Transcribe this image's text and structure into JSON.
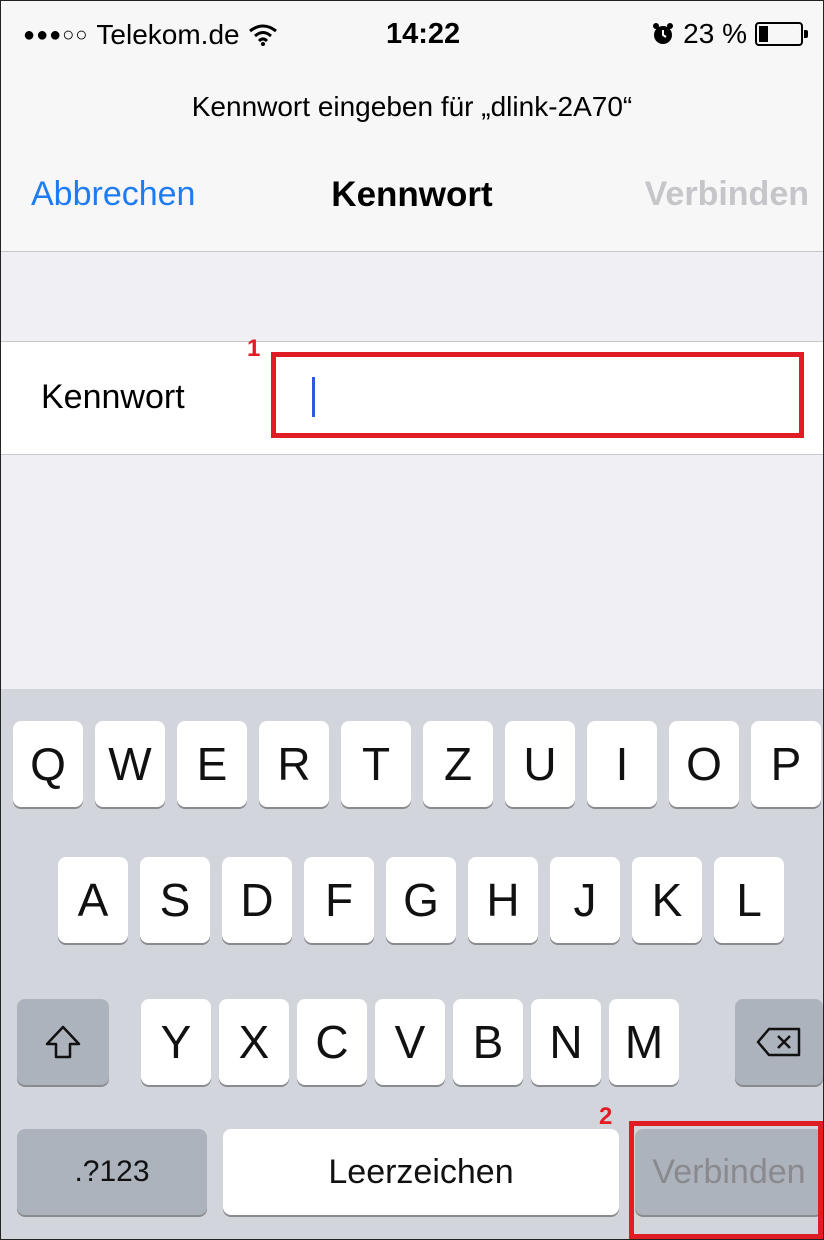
{
  "status_bar": {
    "carrier": "Telekom.de",
    "signal_dots": "●●●○○",
    "time": "14:22",
    "battery_percent": "23 %",
    "battery_level": 0.23
  },
  "navbar": {
    "prompt": "Kennwort eingeben für „dlink-2A70“",
    "cancel_label": "Abbrechen",
    "title": "Kennwort",
    "connect_label": "Verbinden"
  },
  "form": {
    "password_label": "Kennwort",
    "password_value": ""
  },
  "annotations": {
    "marker_1": "1",
    "marker_2": "2"
  },
  "keyboard": {
    "row1": [
      "Q",
      "W",
      "E",
      "R",
      "T",
      "Z",
      "U",
      "I",
      "O",
      "P"
    ],
    "row2": [
      "A",
      "S",
      "D",
      "F",
      "G",
      "H",
      "J",
      "K",
      "L"
    ],
    "row3": [
      "Y",
      "X",
      "C",
      "V",
      "B",
      "N",
      "M"
    ],
    "numbers_label": ".?123",
    "space_label": "Leerzeichen",
    "return_label": "Verbinden"
  },
  "colors": {
    "accent": "#1e7cf2",
    "highlight": "#e01c24"
  }
}
